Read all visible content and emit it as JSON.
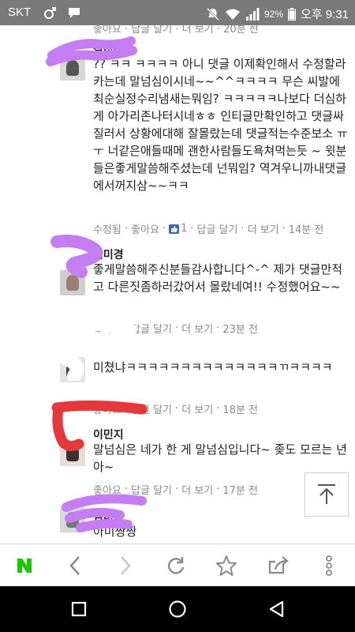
{
  "status_bar": {
    "carrier": "SKT",
    "battery": "92%",
    "time": "오후 9:31"
  },
  "top_meta": "좋아요 · 답글 달기 · 더 보기 · 20분 전",
  "comments": [
    {
      "name": "김미경",
      "text": "?? ㅋㅋ ㅋㅋㅋㅋ 아니 댓글 이제확인해서 수정할라카는데 말넘심이시네~~^^ㅋㅋㅋㅋ 무슨 씨발에 최순실정수리냄새는뭐임? ㅋㅋㅋㅋㅋ나보다 더심하게 아가리존나터시네ㅎㅎ 인티글만확인하고 댓글싸질러서 상황에대해 잘몰랐는데 댓글적는수준보소 ㅠㅜ 너같은애들때메 괜한사람들도욕쳐먹는듯 ~ 윗분들은좋게말씀해주셨는데 넌뭐임? 역겨우니까내댓글에서꺼지삼~~ㅋㅋ",
      "meta": {
        "edited": "수정됨",
        "like": "좋아요",
        "like_count": "1",
        "reply": "답글 달기",
        "more": "더 보기",
        "time": "14분 전"
      }
    },
    {
      "name": "김미경",
      "text": "좋게말씀해주신분들감사합니다^-^ 제가 댓글만적고 다른짓좀하러갔어서 몰랐네여!! 수정했어요~~",
      "meta": {
        "like": "좋아요",
        "reply": "답글 달기",
        "more": "더 보기",
        "time": "23분 전"
      }
    },
    {
      "name": "",
      "text": "미쳤냐ㅋㅋㅋㅋㅋㅋㅋㅋㅋㅋㅋㅋㅋㅋㄲㅋㅋㅋㅋ",
      "meta": {
        "like": "좋아요",
        "reply": "답글 달기",
        "more": "더 보기",
        "time": "18분 전"
      }
    },
    {
      "name": "이민지",
      "text": "말넘심은 네가 한 게 말넘심입니다~ 좆도 모르는 년아~",
      "meta": {
        "like": "좋아요",
        "reply": "답글 달기",
        "more": "더 보기",
        "time": "17분 전"
      }
    },
    {
      "name": "김미경",
      "text": "아미짱짱"
    }
  ],
  "colors": {
    "status_bar": "#7a7a7a",
    "naver_green": "#1ec800",
    "scribble_purple": "#c57df2",
    "scribble_red": "#e4393c",
    "toolbar_icon": "#9a9a9a"
  },
  "icons": {
    "naver": "N",
    "back": "chevron-left-icon",
    "forward": "chevron-right-icon",
    "reload": "reload-icon",
    "bookmark": "star-icon",
    "share": "share-icon",
    "menu": "kebab-icon",
    "scroll_top": "arrow-up-icon"
  }
}
